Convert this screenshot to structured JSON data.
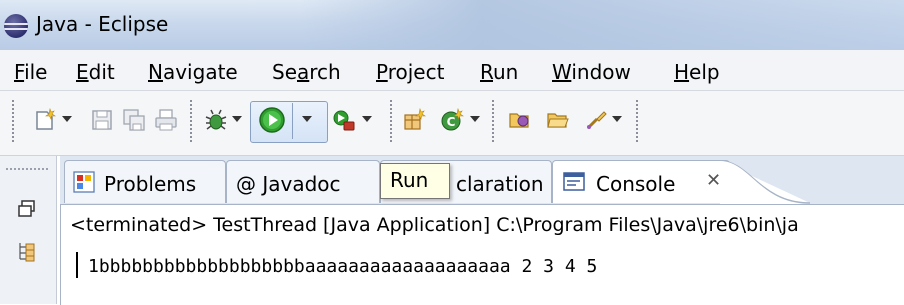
{
  "window": {
    "title": "Java - Eclipse"
  },
  "menu": {
    "items": [
      {
        "label": "File",
        "mnemonic": "F"
      },
      {
        "label": "Edit",
        "mnemonic": "E"
      },
      {
        "label": "Navigate",
        "mnemonic": "N"
      },
      {
        "label": "Search",
        "mnemonic": "a"
      },
      {
        "label": "Project",
        "mnemonic": "P"
      },
      {
        "label": "Run",
        "mnemonic": "R"
      },
      {
        "label": "Window",
        "mnemonic": "W"
      },
      {
        "label": "Help",
        "mnemonic": "H"
      }
    ]
  },
  "toolbar": {
    "icons": [
      "new-icon",
      "save-icon",
      "save-all-icon",
      "print-icon",
      "debug-icon",
      "run-icon",
      "external-tools-icon",
      "new-java-package-icon",
      "new-java-class-icon",
      "open-type-icon",
      "open-folder-icon",
      "search-icon"
    ],
    "tooltip": "Run"
  },
  "views": {
    "tabs": [
      {
        "label": "Problems",
        "icon": "problems-icon"
      },
      {
        "label": "@ Javadoc",
        "icon": "javadoc-icon"
      },
      {
        "label": "claration",
        "icon": "declaration-icon"
      },
      {
        "label": "Console",
        "icon": "console-icon",
        "active": true
      }
    ],
    "close_glyph": "✕"
  },
  "console": {
    "header": "<terminated> TestThread [Java Application] C:\\Program Files\\Java\\jre6\\bin\\ja",
    "output": "1bbbbbbbbbbbbbbbbbbbaaaaaaaaaaaaaaaaaaa 2 3 4 5"
  },
  "colors": {
    "titlebar": "#c9d8ec",
    "run_green": "#2f9e2f",
    "console_bg": "#ffffff"
  }
}
